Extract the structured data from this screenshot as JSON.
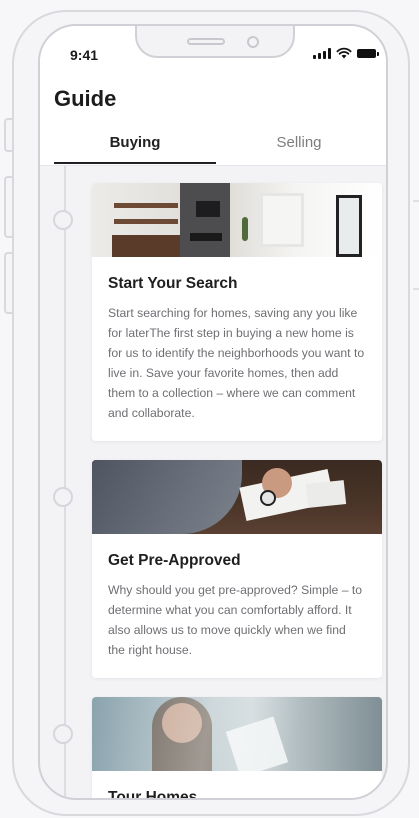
{
  "status_bar": {
    "time": "9:41"
  },
  "header": {
    "title": "Guide"
  },
  "tabs": [
    {
      "label": "Buying",
      "active": true
    },
    {
      "label": "Selling",
      "active": false
    }
  ],
  "steps": [
    {
      "title": "Start Your Search",
      "body": "Start searching for homes, saving any you like for laterThe first step in buying a new home is for us to identify the neighborhoods you want to live in. Save your favorite homes, then add them to a collection – where we can comment and collaborate.",
      "image": "living-room-photo"
    },
    {
      "title": "Get Pre-Approved",
      "body": "Why should you get pre-approved? Simple – to determine what you can comfortably afford. It also allows us to move quickly when we find the right house.",
      "image": "signing-documents-photo"
    },
    {
      "title": "Tour Homes",
      "body": "",
      "image": "tour-homes-photo"
    }
  ],
  "colors": {
    "accent": "#1f1f26",
    "background": "#f3f3f6",
    "card": "#ffffff",
    "muted_text": "#6f6f74"
  },
  "icons": [
    "signal-icon",
    "wifi-icon",
    "battery-icon"
  ]
}
